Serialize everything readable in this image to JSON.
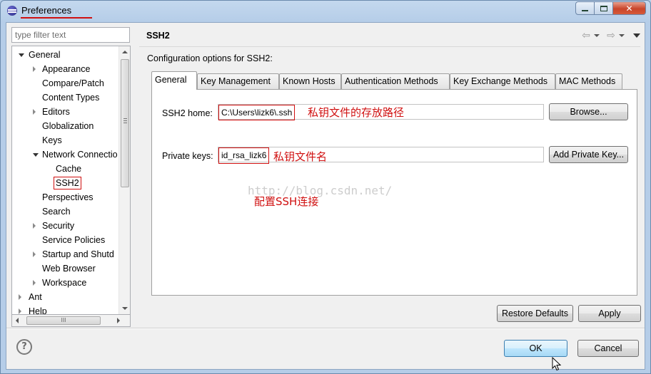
{
  "window": {
    "title": "Preferences",
    "minimize_icon": "minimize-icon",
    "maximize_icon": "maximize-icon",
    "close_glyph": "✕"
  },
  "filter": {
    "placeholder": "type filter text"
  },
  "tree": {
    "items": [
      {
        "label": "General",
        "depth": 0,
        "state": "open"
      },
      {
        "label": "Appearance",
        "depth": 1,
        "state": "closed"
      },
      {
        "label": "Compare/Patch",
        "depth": 1,
        "state": "leaf"
      },
      {
        "label": "Content Types",
        "depth": 1,
        "state": "leaf"
      },
      {
        "label": "Editors",
        "depth": 1,
        "state": "closed"
      },
      {
        "label": "Globalization",
        "depth": 1,
        "state": "leaf"
      },
      {
        "label": "Keys",
        "depth": 1,
        "state": "leaf"
      },
      {
        "label": "Network Connectio",
        "depth": 1,
        "state": "open"
      },
      {
        "label": "Cache",
        "depth": 2,
        "state": "leaf"
      },
      {
        "label": "SSH2",
        "depth": 2,
        "state": "leaf",
        "selected": true
      },
      {
        "label": "Perspectives",
        "depth": 1,
        "state": "leaf"
      },
      {
        "label": "Search",
        "depth": 1,
        "state": "leaf"
      },
      {
        "label": "Security",
        "depth": 1,
        "state": "closed"
      },
      {
        "label": "Service Policies",
        "depth": 1,
        "state": "leaf"
      },
      {
        "label": "Startup and Shutd",
        "depth": 1,
        "state": "closed"
      },
      {
        "label": "Web Browser",
        "depth": 1,
        "state": "leaf"
      },
      {
        "label": "Workspace",
        "depth": 1,
        "state": "closed"
      },
      {
        "label": "Ant",
        "depth": 0,
        "state": "closed"
      },
      {
        "label": "Help",
        "depth": 0,
        "state": "closed"
      }
    ],
    "hscroll_grip": "III"
  },
  "page": {
    "title": "SSH2",
    "description": "Configuration options for SSH2:",
    "nav_back_icon": "back-arrow-icon",
    "nav_forward_icon": "forward-arrow-icon",
    "view_menu_icon": "view-menu-icon"
  },
  "tabs": [
    {
      "label": "General",
      "active": true
    },
    {
      "label": "Key Management"
    },
    {
      "label": "Known Hosts"
    },
    {
      "label": "Authentication Methods"
    },
    {
      "label": "Key Exchange Methods"
    },
    {
      "label": "MAC Methods"
    }
  ],
  "general_tab": {
    "ssh2_home_label": "SSH2 home:",
    "ssh2_home_value": "C:\\Users\\lizk6\\.ssh",
    "ssh2_home_note": "私钥文件的存放路径",
    "browse_label": "Browse...",
    "private_keys_label": "Private keys:",
    "private_keys_value": "id_rsa_lizk6",
    "private_keys_note": "私钥文件名",
    "add_key_label": "Add Private Key...",
    "center_note": "配置SSH连接",
    "watermark": "http://blog.csdn.net/"
  },
  "buttons": {
    "restore_defaults": "Restore Defaults",
    "apply": "Apply",
    "ok": "OK",
    "cancel": "Cancel",
    "help_glyph": "?"
  },
  "colors": {
    "annotation_red": "#d01010",
    "primary_button": "#bee6fd"
  }
}
